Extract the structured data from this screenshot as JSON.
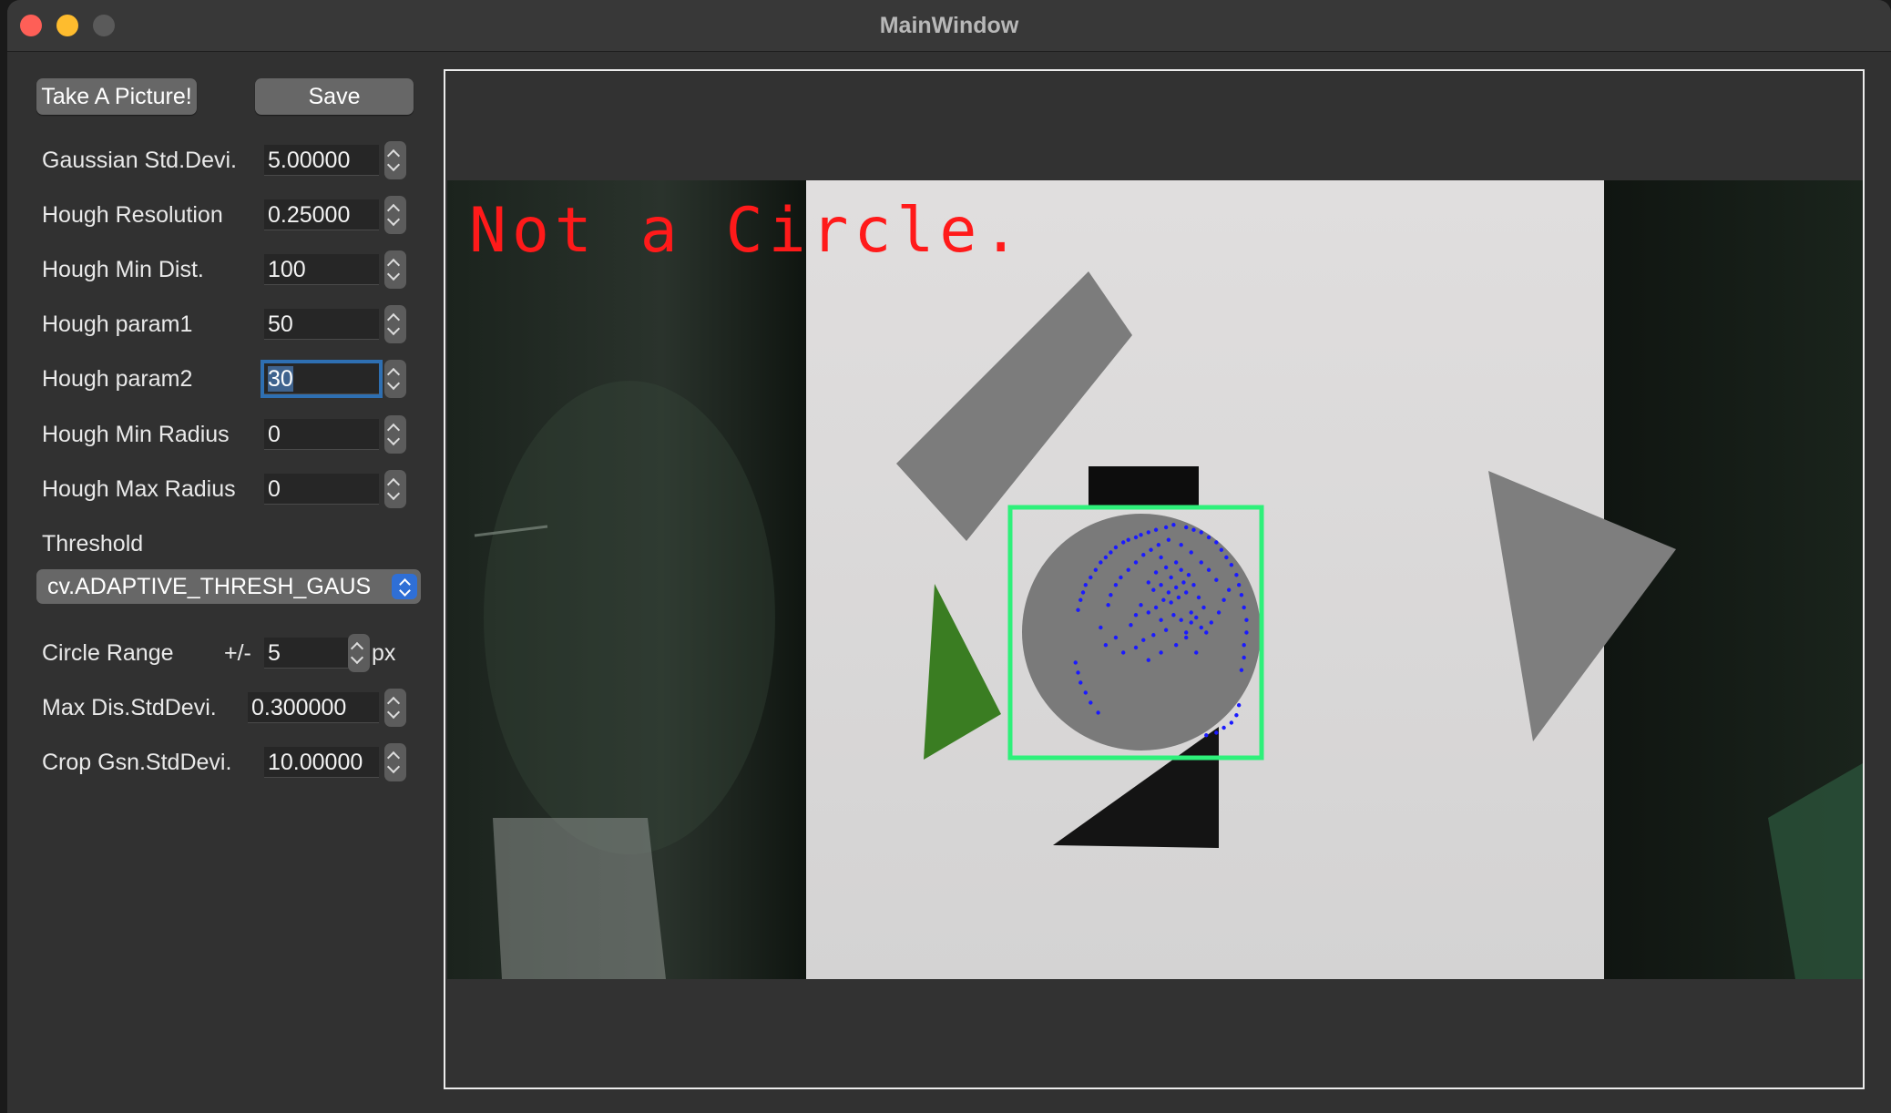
{
  "window": {
    "title": "MainWindow"
  },
  "toolbar": {
    "take_picture_label": "Take A Picture!",
    "save_label": "Save"
  },
  "params": {
    "gaussian": {
      "label": "Gaussian Std.Devi.",
      "value": "5.00000"
    },
    "hough_resolution": {
      "label": "Hough Resolution",
      "value": "0.25000"
    },
    "hough_min_dist": {
      "label": "Hough Min Dist.",
      "value": "100"
    },
    "hough_param1": {
      "label": "Hough param1",
      "value": "50"
    },
    "hough_param2": {
      "label": "Hough param2",
      "value": "30"
    },
    "hough_min_radius": {
      "label": "Hough Min Radius",
      "value": "0"
    },
    "hough_max_radius": {
      "label": "Hough Max Radius",
      "value": "0"
    },
    "threshold": {
      "label": "Threshold",
      "selected": "cv.ADAPTIVE_THRESH_GAUS"
    },
    "circle_range": {
      "label": "Circle Range",
      "prefix": "+/-",
      "value": "5",
      "unit": "px"
    },
    "max_dis_stddevi": {
      "label": "Max Dis.StdDevi.",
      "value": "0.300000"
    },
    "crop_gsn_stddevi": {
      "label": "Crop Gsn.StdDevi.",
      "value": "10.00000"
    }
  },
  "viewer": {
    "overlay_text": "Not a Circle.",
    "colors": {
      "overlay_text": "#ff1a1a",
      "bounding_box": "#2ef07a",
      "points": "#1a1aff"
    },
    "detection": {
      "points": [
        [
          0.65,
          0.07
        ],
        [
          0.62,
          0.08
        ],
        [
          0.58,
          0.09
        ],
        [
          0.55,
          0.1
        ],
        [
          0.52,
          0.11
        ],
        [
          0.5,
          0.12
        ],
        [
          0.47,
          0.13
        ],
        [
          0.45,
          0.14
        ],
        [
          0.42,
          0.16
        ],
        [
          0.4,
          0.18
        ],
        [
          0.38,
          0.2
        ],
        [
          0.36,
          0.22
        ],
        [
          0.34,
          0.25
        ],
        [
          0.32,
          0.28
        ],
        [
          0.3,
          0.31
        ],
        [
          0.29,
          0.34
        ],
        [
          0.28,
          0.37
        ],
        [
          0.27,
          0.41
        ],
        [
          0.7,
          0.08
        ],
        [
          0.73,
          0.09
        ],
        [
          0.76,
          0.1
        ],
        [
          0.79,
          0.12
        ],
        [
          0.82,
          0.14
        ],
        [
          0.84,
          0.17
        ],
        [
          0.86,
          0.2
        ],
        [
          0.88,
          0.23
        ],
        [
          0.9,
          0.27
        ],
        [
          0.91,
          0.31
        ],
        [
          0.92,
          0.35
        ],
        [
          0.93,
          0.4
        ],
        [
          0.94,
          0.45
        ],
        [
          0.94,
          0.5
        ],
        [
          0.93,
          0.55
        ],
        [
          0.93,
          0.6
        ],
        [
          0.92,
          0.65
        ],
        [
          0.26,
          0.62
        ],
        [
          0.27,
          0.66
        ],
        [
          0.28,
          0.7
        ],
        [
          0.3,
          0.74
        ],
        [
          0.32,
          0.78
        ],
        [
          0.35,
          0.82
        ],
        [
          0.6,
          0.2
        ],
        [
          0.62,
          0.24
        ],
        [
          0.58,
          0.26
        ],
        [
          0.64,
          0.28
        ],
        [
          0.66,
          0.22
        ],
        [
          0.68,
          0.25
        ],
        [
          0.55,
          0.3
        ],
        [
          0.57,
          0.33
        ],
        [
          0.6,
          0.31
        ],
        [
          0.63,
          0.34
        ],
        [
          0.66,
          0.32
        ],
        [
          0.69,
          0.3
        ],
        [
          0.71,
          0.27
        ],
        [
          0.73,
          0.31
        ],
        [
          0.7,
          0.34
        ],
        [
          0.67,
          0.36
        ],
        [
          0.64,
          0.38
        ],
        [
          0.61,
          0.37
        ],
        [
          0.58,
          0.4
        ],
        [
          0.55,
          0.42
        ],
        [
          0.52,
          0.39
        ],
        [
          0.5,
          0.43
        ],
        [
          0.48,
          0.47
        ],
        [
          0.6,
          0.45
        ],
        [
          0.75,
          0.36
        ],
        [
          0.77,
          0.4
        ],
        [
          0.72,
          0.42
        ],
        [
          0.68,
          0.45
        ],
        [
          0.65,
          0.43
        ],
        [
          0.62,
          0.49
        ],
        [
          0.57,
          0.51
        ],
        [
          0.53,
          0.53
        ],
        [
          0.5,
          0.56
        ],
        [
          0.45,
          0.58
        ],
        [
          0.42,
          0.52
        ],
        [
          0.38,
          0.55
        ],
        [
          0.36,
          0.48
        ],
        [
          0.66,
          0.55
        ],
        [
          0.7,
          0.52
        ],
        [
          0.74,
          0.58
        ],
        [
          0.78,
          0.5
        ],
        [
          0.8,
          0.46
        ],
        [
          0.83,
          0.42
        ],
        [
          0.85,
          0.37
        ],
        [
          0.87,
          0.33
        ],
        [
          0.82,
          0.29
        ],
        [
          0.79,
          0.25
        ],
        [
          0.76,
          0.22
        ],
        [
          0.72,
          0.18
        ],
        [
          0.68,
          0.15
        ],
        [
          0.63,
          0.13
        ],
        [
          0.59,
          0.15
        ],
        [
          0.56,
          0.17
        ],
        [
          0.53,
          0.19
        ],
        [
          0.5,
          0.22
        ],
        [
          0.47,
          0.25
        ],
        [
          0.44,
          0.28
        ],
        [
          0.42,
          0.31
        ],
        [
          0.4,
          0.35
        ],
        [
          0.39,
          0.39
        ],
        [
          0.85,
          0.88
        ],
        [
          0.82,
          0.9
        ],
        [
          0.78,
          0.91
        ],
        [
          0.88,
          0.86
        ],
        [
          0.9,
          0.83
        ],
        [
          0.91,
          0.79
        ],
        [
          0.7,
          0.5
        ],
        [
          0.72,
          0.46
        ],
        [
          0.74,
          0.44
        ],
        [
          0.76,
          0.48
        ],
        [
          0.6,
          0.58
        ],
        [
          0.55,
          0.61
        ]
      ]
    }
  }
}
